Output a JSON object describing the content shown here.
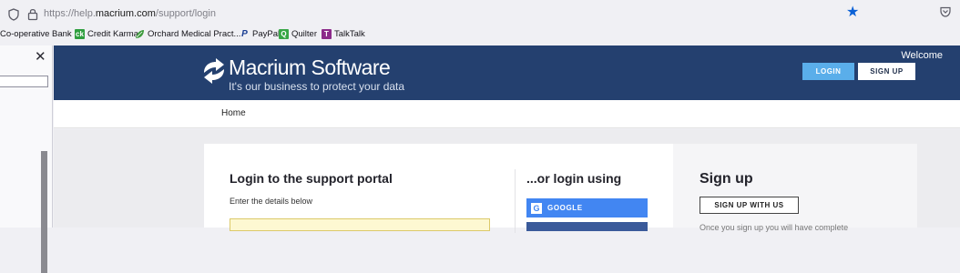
{
  "browser": {
    "url_prefix": "https://help.",
    "url_domain": "macrium.com",
    "url_path": "/support/login"
  },
  "bookmarks": [
    {
      "label": "Co-operative Bank",
      "icon": "coop-icon"
    },
    {
      "label": "Credit Karma",
      "icon": "ck-icon",
      "icon_text": "ck",
      "color": "#2e9e3e"
    },
    {
      "label": "Orchard Medical Pract...",
      "icon": "leaf-icon",
      "color": "#3c9a3c"
    },
    {
      "label": "PayPal",
      "icon": "paypal-icon",
      "icon_text": "P",
      "color": "#1b3f93"
    },
    {
      "label": "Quilter",
      "icon": "quilter-icon",
      "icon_text": "Q",
      "color": "#38a646"
    },
    {
      "label": "TalkTalk",
      "icon": "talktalk-icon",
      "icon_text": "T",
      "color": "#8c2a8a"
    }
  ],
  "header": {
    "brand": "Macrium Software",
    "tagline": "It's our business to protect your data",
    "welcome": "Welcome",
    "login_label": "LOGIN",
    "signup_label": "SIGN UP",
    "color": "#24406f",
    "accent": "#5aaeea"
  },
  "breadcrumb": {
    "home": "Home"
  },
  "login": {
    "title": "Login to the support portal",
    "subtitle": "Enter the details below",
    "alt_title": "...or login using",
    "google_icon_text": "G",
    "google_label": "GOOGLE",
    "google_color": "#4286f2"
  },
  "signup": {
    "title": "Sign up",
    "button_label": "SIGN UP WITH US",
    "note": "Once you sign up you will have complete"
  }
}
